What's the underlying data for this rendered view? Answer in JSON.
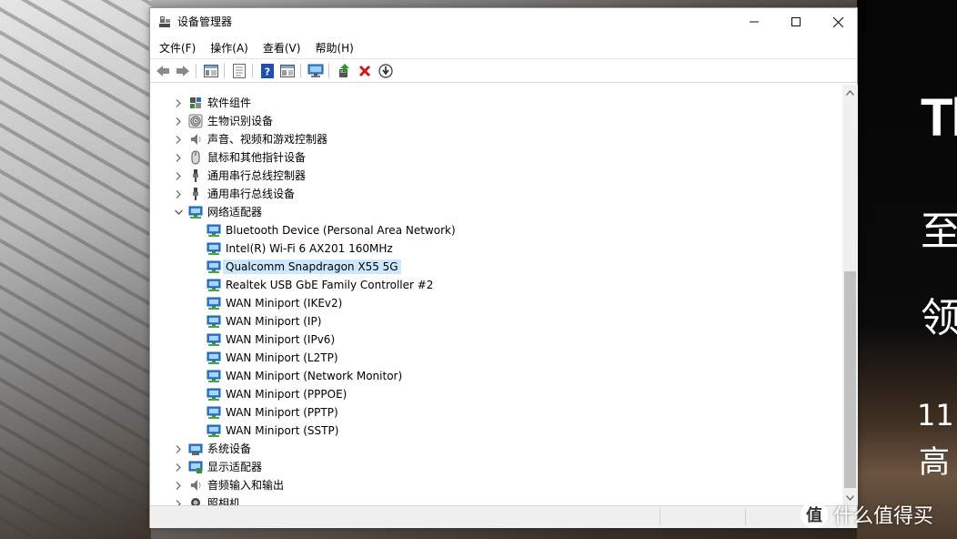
{
  "window": {
    "title": "设备管理器",
    "controls": {
      "minimize": "—",
      "maximize": "☐",
      "close": "✕"
    }
  },
  "menu": [
    "文件(F)",
    "操作(A)",
    "查看(V)",
    "帮助(H)"
  ],
  "toolbar": {
    "buttons": [
      "back-icon",
      "forward-icon",
      "properties-icon",
      "show-hide-icon",
      "help-icon",
      "view-icon",
      "scan-hardware-icon",
      "update-driver-icon",
      "uninstall-icon",
      "disable-icon"
    ]
  },
  "tree": {
    "items": [
      {
        "label": "软件组件",
        "level": 0,
        "state": "collapsed",
        "icon": "software-component-icon"
      },
      {
        "label": "生物识别设备",
        "level": 0,
        "state": "collapsed",
        "icon": "fingerprint-icon"
      },
      {
        "label": "声音、视频和游戏控制器",
        "level": 0,
        "state": "collapsed",
        "icon": "speaker-icon"
      },
      {
        "label": "鼠标和其他指针设备",
        "level": 0,
        "state": "collapsed",
        "icon": "mouse-icon"
      },
      {
        "label": "通用串行总线控制器",
        "level": 0,
        "state": "collapsed",
        "icon": "usb-icon"
      },
      {
        "label": "通用串行总线设备",
        "level": 0,
        "state": "collapsed",
        "icon": "usb-icon"
      },
      {
        "label": "网络适配器",
        "level": 0,
        "state": "expanded",
        "icon": "network-adapter-icon"
      },
      {
        "label": "Bluetooth Device (Personal Area Network)",
        "level": 1,
        "icon": "network-adapter-icon"
      },
      {
        "label": "Intel(R) Wi-Fi 6 AX201 160MHz",
        "level": 1,
        "icon": "network-adapter-icon"
      },
      {
        "label": "Qualcomm Snapdragon X55 5G",
        "level": 1,
        "icon": "network-adapter-icon",
        "selected": true
      },
      {
        "label": "Realtek USB GbE Family Controller #2",
        "level": 1,
        "icon": "network-adapter-icon"
      },
      {
        "label": "WAN Miniport (IKEv2)",
        "level": 1,
        "icon": "network-adapter-icon"
      },
      {
        "label": "WAN Miniport (IP)",
        "level": 1,
        "icon": "network-adapter-icon"
      },
      {
        "label": "WAN Miniport (IPv6)",
        "level": 1,
        "icon": "network-adapter-icon"
      },
      {
        "label": "WAN Miniport (L2TP)",
        "level": 1,
        "icon": "network-adapter-icon"
      },
      {
        "label": "WAN Miniport (Network Monitor)",
        "level": 1,
        "icon": "network-adapter-icon"
      },
      {
        "label": "WAN Miniport (PPPOE)",
        "level": 1,
        "icon": "network-adapter-icon"
      },
      {
        "label": "WAN Miniport (PPTP)",
        "level": 1,
        "icon": "network-adapter-icon"
      },
      {
        "label": "WAN Miniport (SSTP)",
        "level": 1,
        "icon": "network-adapter-icon"
      },
      {
        "label": "系统设备",
        "level": 0,
        "state": "collapsed",
        "icon": "system-device-icon"
      },
      {
        "label": "显示适配器",
        "level": 0,
        "state": "collapsed",
        "icon": "display-adapter-icon"
      },
      {
        "label": "音频输入和输出",
        "level": 0,
        "state": "collapsed",
        "icon": "speaker-icon"
      },
      {
        "label": "照相机",
        "level": 0,
        "state": "collapsed",
        "icon": "camera-icon"
      }
    ]
  },
  "background": {
    "right_text": [
      "Th",
      "至",
      "领",
      "11",
      "高"
    ],
    "watermark": {
      "logo": "值",
      "text": "什么值得买"
    }
  },
  "colors": {
    "selection": "#cce8ff",
    "help_blue": "#1e4fb4",
    "uninstall_red": "#d01818",
    "update_green": "#2a9a2a"
  }
}
